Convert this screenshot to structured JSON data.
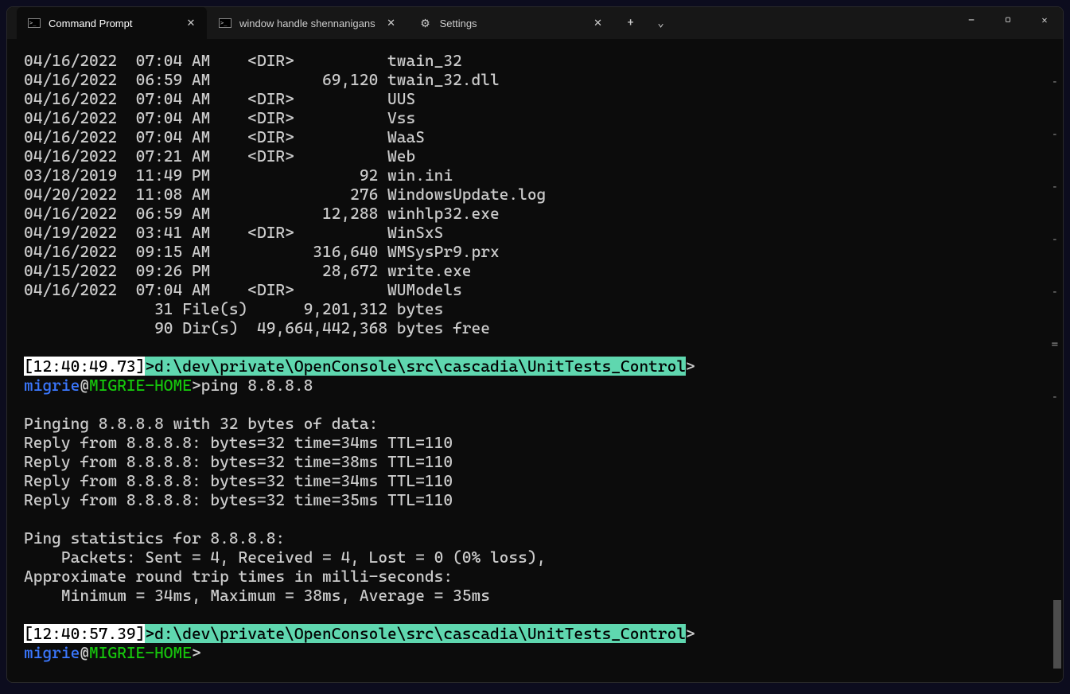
{
  "tabs": [
    {
      "label": "Command Prompt",
      "icon": "cmd",
      "active": true
    },
    {
      "label": "window handle shennanigans",
      "icon": "cmd",
      "active": false
    },
    {
      "label": "Settings",
      "icon": "gear",
      "active": false
    }
  ],
  "window_controls": {
    "minimize": "—",
    "maximize": "▢",
    "close": "✕"
  },
  "tab_buttons": {
    "add": "+",
    "dropdown": "⌄"
  },
  "dir_listing": [
    "04/16/2022  07:04 AM    <DIR>          twain_32",
    "04/16/2022  06:59 AM            69,120 twain_32.dll",
    "04/16/2022  07:04 AM    <DIR>          UUS",
    "04/16/2022  07:04 AM    <DIR>          Vss",
    "04/16/2022  07:04 AM    <DIR>          WaaS",
    "04/16/2022  07:21 AM    <DIR>          Web",
    "03/18/2019  11:49 PM                92 win.ini",
    "04/20/2022  11:08 AM               276 WindowsUpdate.log",
    "04/16/2022  06:59 AM            12,288 winhlp32.exe",
    "04/19/2022  03:41 AM    <DIR>          WinSxS",
    "04/16/2022  09:15 AM           316,640 WMSysPr9.prx",
    "04/15/2022  09:26 PM            28,672 write.exe",
    "04/16/2022  07:04 AM    <DIR>          WUModels",
    "              31 File(s)      9,201,312 bytes",
    "              90 Dir(s)  49,664,442,368 bytes free"
  ],
  "prompt1": {
    "timestamp": "[12:40:49.73]",
    "arrow": ">",
    "path": "d:\\dev\\private\\OpenConsole\\src\\cascadia\\UnitTests_Control",
    "trail": ">",
    "user": "migrie",
    "at": "@",
    "host": "MIGRIE-HOME",
    "sep": ">",
    "command": "ping 8.8.8.8"
  },
  "ping_output": [
    "",
    "Pinging 8.8.8.8 with 32 bytes of data:",
    "Reply from 8.8.8.8: bytes=32 time=34ms TTL=110",
    "Reply from 8.8.8.8: bytes=32 time=38ms TTL=110",
    "Reply from 8.8.8.8: bytes=32 time=34ms TTL=110",
    "Reply from 8.8.8.8: bytes=32 time=35ms TTL=110",
    "",
    "Ping statistics for 8.8.8.8:",
    "    Packets: Sent = 4, Received = 4, Lost = 0 (0% loss),",
    "Approximate round trip times in milli-seconds:",
    "    Minimum = 34ms, Maximum = 38ms, Average = 35ms",
    ""
  ],
  "prompt2": {
    "timestamp": "[12:40:57.39]",
    "arrow": ">",
    "path": "d:\\dev\\private\\OpenConsole\\src\\cascadia\\UnitTests_Control",
    "trail": ">",
    "user": "migrie",
    "at": "@",
    "host": "MIGRIE-HOME",
    "sep": ">",
    "command": ""
  },
  "side_marks": [
    "-",
    "-",
    "-",
    "-",
    "-",
    "=",
    "-"
  ]
}
